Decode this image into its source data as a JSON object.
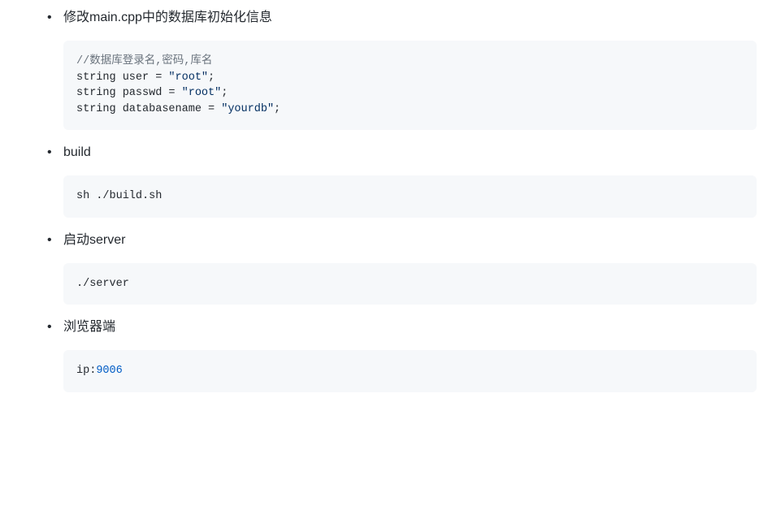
{
  "items": [
    {
      "label": "修改main.cpp中的数据库初始化信息",
      "code": {
        "type": "cpp",
        "lines": [
          {
            "tokens": [
              {
                "t": "comment",
                "v": "//数据库登录名,密码,库名"
              }
            ]
          },
          {
            "tokens": [
              {
                "t": "keyword",
                "v": "string user = "
              },
              {
                "t": "string",
                "v": "\"root\""
              },
              {
                "t": "keyword",
                "v": ";"
              }
            ]
          },
          {
            "tokens": [
              {
                "t": "keyword",
                "v": "string passwd = "
              },
              {
                "t": "string",
                "v": "\"root\""
              },
              {
                "t": "keyword",
                "v": ";"
              }
            ]
          },
          {
            "tokens": [
              {
                "t": "keyword",
                "v": "string databasename = "
              },
              {
                "t": "string",
                "v": "\"yourdb\""
              },
              {
                "t": "keyword",
                "v": ";"
              }
            ]
          }
        ]
      }
    },
    {
      "label": "build",
      "code": {
        "type": "shell",
        "lines": [
          {
            "tokens": [
              {
                "t": "keyword",
                "v": "sh ./build.sh"
              }
            ]
          }
        ]
      }
    },
    {
      "label": "启动server",
      "code": {
        "type": "shell",
        "lines": [
          {
            "tokens": [
              {
                "t": "keyword",
                "v": "./server"
              }
            ]
          }
        ]
      }
    },
    {
      "label": "浏览器端",
      "code": {
        "type": "shell",
        "lines": [
          {
            "tokens": [
              {
                "t": "keyword",
                "v": "ip:"
              },
              {
                "t": "number",
                "v": "9006"
              }
            ]
          }
        ]
      }
    }
  ]
}
